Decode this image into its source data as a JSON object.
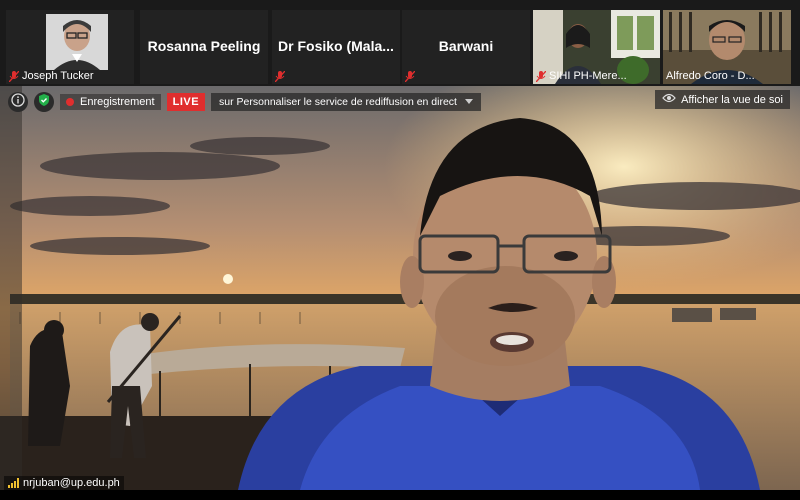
{
  "participants": [
    {
      "name": "Joseph Tucker",
      "display": "label",
      "has_video": false,
      "muted": true
    },
    {
      "name": "Rosanna Peeling",
      "display": "big",
      "has_video": false,
      "muted": false
    },
    {
      "name": "Dr Fosiko  (Mala...",
      "display": "big",
      "has_video": false,
      "muted": true
    },
    {
      "name": "Barwani",
      "display": "big",
      "has_video": false,
      "muted": true
    },
    {
      "name": "SIHI PH-Mere...",
      "display": "label",
      "has_video": true,
      "muted": true
    },
    {
      "name": "Alfredo Coro - D...",
      "display": "label",
      "has_video": true,
      "muted": false
    }
  ],
  "toolbar": {
    "recording_label": "Enregistrement",
    "live_label": "LIVE",
    "live_select_text": "sur Personnaliser le service de rediffusion en direct"
  },
  "self_view_label": "Afficher la vue de soi",
  "speaker_label": "nrjuban@up.edu.ph",
  "colors": {
    "live_red": "#e02e2e",
    "strip_bg": "#1a1a1a",
    "shield_green": "#23b04a"
  },
  "icons": {
    "info": "info-icon",
    "shield": "shield-check-icon",
    "eye": "eye-icon",
    "mic_muted": "mic-muted-icon"
  }
}
